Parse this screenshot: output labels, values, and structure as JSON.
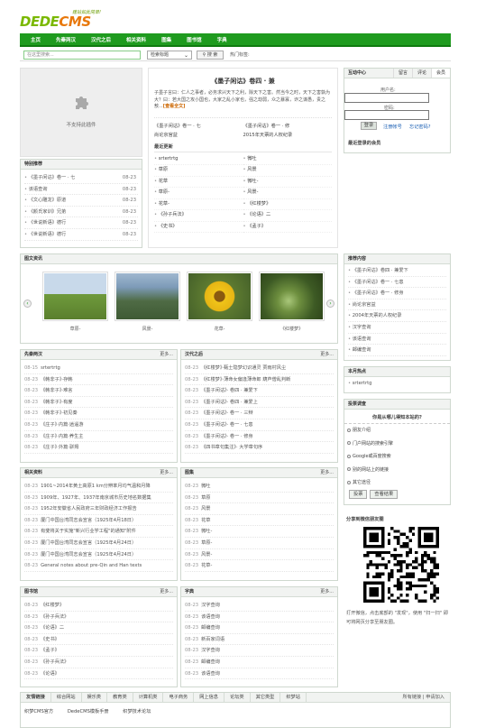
{
  "header": {
    "brand_a": "DEDE",
    "brand_b": "CMS",
    "slogan": "建站如此简单!"
  },
  "nav": [
    "主页",
    "先秦两汉",
    "汉代之后",
    "相关资料",
    "图集",
    "图书馆",
    "字典"
  ],
  "search": {
    "placeholder": "在这里搜索...",
    "select_value": "检索标题",
    "button": "搜 索",
    "hot_label": "热门标签:"
  },
  "flash": {
    "text": "不支持此插件"
  },
  "featured": {
    "title": "《墨子闲诂》卷四 · 兼",
    "intro": "子墨子言曰：仁人之事者，必务求兴天下之利，除天下之害。然当今之时，天下之害孰为大？曰：若大国之攻小国也，大家之乱小家也，强之劫弱，众之暴寡，诈之谋愚，贵之敖...",
    "intro_link": "[查看全文]",
    "pairs": [
      "《墨子闲诂》卷一 · 七",
      "《墨子闲诂》卷一 · 修",
      "尚论京官益",
      "2015年天票的人权纪录"
    ],
    "sub": "最近更新",
    "grid": [
      "srtertrtg",
      "微吐",
      "草原",
      "风景",
      "花草",
      "微吐-",
      "草原-",
      "风景-",
      "花草-",
      "《红楼梦》",
      "《孙子兵法》",
      "《论语》二",
      "《史书》",
      "《孟子》"
    ]
  },
  "login": {
    "title": "互动中心",
    "tabs": [
      "留言",
      "评论",
      "会员"
    ],
    "user_label": "用户名:",
    "pwd_label": "密码:",
    "submit": "登录",
    "register": "注册帐号",
    "forgot": "忘记密码?",
    "recent": "最近登录的会员"
  },
  "tj": {
    "title": "特别推荐",
    "items": [
      {
        "t": "《墨子闲诂》卷一 · 七",
        "d": "08-23"
      },
      {
        "t": "该语查询",
        "d": "08-23"
      },
      {
        "t": "《文心雕龙》原道",
        "d": "08-23"
      },
      {
        "t": "《颜氏家训》兄弟",
        "d": "08-23"
      },
      {
        "t": "《世说新语》德行",
        "d": "08-23"
      },
      {
        "t": "《世说新语》德行",
        "d": "08-23"
      }
    ]
  },
  "pics": {
    "title": "图文资讯",
    "items": [
      "草原-",
      "风景-",
      "花草-",
      "《红楼梦》"
    ],
    "colors": [
      "#5f8e3a",
      "#6d8aa8",
      "#d4b21f",
      "#4a6b2f"
    ]
  },
  "recommend": {
    "title": "推荐内容",
    "items": [
      "《墨子闲诂》卷四 · 兼爱下",
      "《墨子闲诂》卷一 · 七患",
      "《墨子闲诂》卷一 · 修身",
      "尚论京官益",
      "2004年天票的人权纪录",
      "汉字查询",
      "该语查询",
      "邮编查询"
    ]
  },
  "hot": {
    "title": "本月热点",
    "items": [
      "srtertrtg"
    ]
  },
  "vote": {
    "title": "投票调查",
    "question": "你是从哪儿得知本站的?",
    "options": [
      "朋友介绍",
      "门户网站的搜索引擎",
      "Google或百度搜索",
      "别的网站上的链接",
      "其它途径"
    ],
    "btn_vote": "投票",
    "btn_view": "查看结果"
  },
  "share": {
    "title": "分享到微信朋友圈",
    "desc": "打开微信，点击底部的 \"发现\"，使用 \"扫一扫\" 即可将网页分享至朋友圈。"
  },
  "qs": {
    "title": "先秦两汉",
    "more": "更多...",
    "items": [
      {
        "d": "08-15",
        "t": "srtertrtg"
      },
      {
        "d": "08-23",
        "t": "《韩非子》·存韩"
      },
      {
        "d": "08-23",
        "t": "《韩非子》·难言"
      },
      {
        "d": "08-23",
        "t": "《韩非子》·有度"
      },
      {
        "d": "08-23",
        "t": "《韩非子》·初见秦"
      },
      {
        "d": "08-23",
        "t": "《庄子》·内篇·逍遥游"
      },
      {
        "d": "08-23",
        "t": "《庄子》·内篇·养生主"
      },
      {
        "d": "08-23",
        "t": "《庄子》·外篇·骈拇"
      }
    ]
  },
  "hd": {
    "title": "汉代之后",
    "more": "更多...",
    "items": [
      {
        "d": "08-23",
        "t": "《红楼梦》·甄士隐梦幻识通灵 贾雨村风尘"
      },
      {
        "d": "08-23",
        "t": "《红楼梦》·薄命女偏逢薄命郎 葫芦僧乱判断"
      },
      {
        "d": "08-23",
        "t": "《墨子闲诂》· 卷四 · 兼爱下"
      },
      {
        "d": "08-23",
        "t": "《墨子闲诂》· 卷四 · 兼爱上"
      },
      {
        "d": "08-23",
        "t": "《墨子闲诂》· 卷一 · 三辩"
      },
      {
        "d": "08-23",
        "t": "《墨子闲诂》· 卷一 · 七患"
      },
      {
        "d": "08-23",
        "t": "《墨子闲诂》· 卷一 · 修身"
      },
      {
        "d": "08-23",
        "t": "《四书章句集注》· 大学章句序"
      }
    ]
  },
  "xg": {
    "title": "相关资料",
    "more": "更多...",
    "items": [
      {
        "d": "08-23",
        "t": "1901~2014年黄土高原1 km分辨率月均气温和月降"
      },
      {
        "d": "08-23",
        "t": "1909年、1927年、1937年南京城市历史地名数据集"
      },
      {
        "d": "08-23",
        "t": "1952年安徽省人民政府三年财政经济工作报告"
      },
      {
        "d": "08-23",
        "t": "厦门中国台湾同志会宣言（1925年4月18日）"
      },
      {
        "d": "08-23",
        "t": "有斐将关于实施\"新兴行业学工程\"的通知\"附件"
      },
      {
        "d": "08-23",
        "t": "厦门中国台湾同志会宣言（1925年4月24日）"
      },
      {
        "d": "08-23",
        "t": "厦门中国台湾同志会宣言（1925年4月24日）"
      },
      {
        "d": "08-23",
        "t": "General notes about pre-Qin and Han texts"
      }
    ]
  },
  "tj2": {
    "title": "图集",
    "more": "更多...",
    "items": [
      {
        "d": "08-23",
        "t": "微吐"
      },
      {
        "d": "08-23",
        "t": "草原"
      },
      {
        "d": "08-23",
        "t": "风景"
      },
      {
        "d": "08-23",
        "t": "花草"
      },
      {
        "d": "08-23",
        "t": "微吐-"
      },
      {
        "d": "08-23",
        "t": "草原-"
      },
      {
        "d": "08-23",
        "t": "风景-"
      },
      {
        "d": "08-23",
        "t": "花草-"
      }
    ]
  },
  "tsg": {
    "title": "图书馆",
    "more": "更多...",
    "items": [
      {
        "d": "08-23",
        "t": "《红楼梦》"
      },
      {
        "d": "08-23",
        "t": "《孙子兵法》"
      },
      {
        "d": "08-23",
        "t": "《论语》二"
      },
      {
        "d": "08-23",
        "t": "《史书》"
      },
      {
        "d": "08-23",
        "t": "《孟子》"
      },
      {
        "d": "08-23",
        "t": "《孙子兵法》"
      },
      {
        "d": "08-23",
        "t": "《论语》"
      }
    ]
  },
  "zd": {
    "title": "字典",
    "more": "更多...",
    "items": [
      {
        "d": "08-23",
        "t": "汉字查询"
      },
      {
        "d": "08-23",
        "t": "该语查询"
      },
      {
        "d": "08-23",
        "t": "邮编查询"
      },
      {
        "d": "08-23",
        "t": "新百家词语"
      },
      {
        "d": "08-23",
        "t": "汉字查询"
      },
      {
        "d": "08-23",
        "t": "邮编查询"
      },
      {
        "d": "08-23",
        "t": "该语查询"
      }
    ]
  },
  "links": {
    "title": "友情链接",
    "cats": [
      "综合网站",
      "娱乐类",
      "教育类",
      "计算机类",
      "电子商务",
      "网上信息",
      "论坛类",
      "其它类型",
      "织梦站"
    ],
    "right": "所有链接 | 申请加入",
    "row": [
      "织梦CMS官方",
      "DedeCMS模板手册",
      "织梦技术论坛"
    ]
  }
}
